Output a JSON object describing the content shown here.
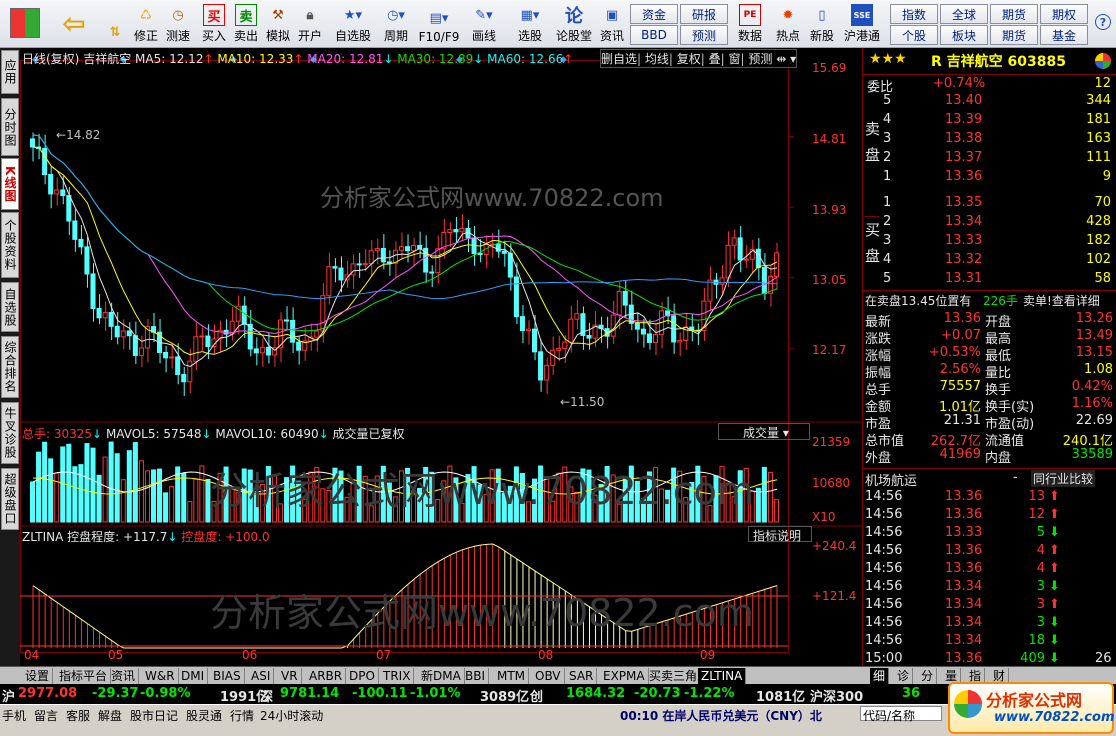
{
  "toolbar": {
    "buttons": [
      "修正",
      "测速",
      "买入",
      "卖出",
      "模拟",
      "开户",
      "自选股",
      "周期",
      "F10/F9",
      "画线",
      "选股",
      "论股堂",
      "资讯",
      "数据",
      "热点",
      "新股",
      "沪港通"
    ],
    "grid_top": [
      "资金",
      "研报"
    ],
    "grid_bottom": [
      "BBD",
      "预测"
    ],
    "right_top": [
      "指数",
      "全球",
      "期货",
      "期权"
    ],
    "right_bottom": [
      "个股",
      "板块",
      "期货",
      "基金"
    ]
  },
  "left_tabs": [
    "应用",
    "分时图",
    "K线图",
    "个股资料",
    "自选股",
    "综合排名",
    "牛叉诊股",
    "超级盘口"
  ],
  "chart": {
    "header": {
      "period": "日线(复权)",
      "name": "吉祥航空",
      "ma5": "MA5: 12.12",
      "ma10": "MA10: 12.33",
      "ma20": "MA20: 12.81",
      "ma30": "MA30: 12.89",
      "ma60": "MA60: 12.66"
    },
    "top_buttons": [
      "删自选",
      "均线",
      "复权",
      "叠",
      "窗",
      "预测"
    ],
    "price_ticks": [
      "15.69",
      "14.81",
      "13.93",
      "13.05",
      "12.17"
    ],
    "high_label": "14.82",
    "low_label": "11.50",
    "volume": {
      "label": "总手: 30325",
      "mavol5": "MAVOL5: 57548",
      "mavol10": "MAVOL10: 60490",
      "note": "成交量已复权",
      "dropdown": "成交量",
      "ticks": [
        "21359",
        "10680",
        "X10"
      ]
    },
    "indicator": {
      "name": "ZLTINA",
      "a": "控盘程度: +117.7",
      "b": "控盘度: +100.0",
      "btn": "指标说明",
      "ticks": [
        "+240.4",
        "+121.4"
      ]
    },
    "months": [
      "04",
      "05",
      "06",
      "07",
      "08",
      "09"
    ],
    "watermark": "分析家公式网www.70822.com"
  },
  "chart_data": {
    "type": "candlestick",
    "title": "吉祥航空 日线(复权)",
    "ylim": [
      11.3,
      15.69
    ],
    "ma": {
      "MA5": 12.12,
      "MA10": 12.33,
      "MA20": 12.81,
      "MA30": 12.89,
      "MA60": 12.66
    },
    "high": 14.82,
    "low": 11.5,
    "volume_ylim": [
      0,
      21359
    ],
    "indicator_ylim": [
      0,
      240.4
    ]
  },
  "quote": {
    "title": "R 吉祥航空 603885",
    "weibi_label": "委比",
    "weibi": "+0.74%",
    "weibi_v": "12",
    "sell": [
      {
        "n": "5",
        "p": "13.40",
        "v": "344"
      },
      {
        "n": "4",
        "p": "13.39",
        "v": "181"
      },
      {
        "n": "3",
        "p": "13.38",
        "v": "163"
      },
      {
        "n": "2",
        "p": "13.37",
        "v": "111"
      },
      {
        "n": "1",
        "p": "13.36",
        "v": "9"
      }
    ],
    "buy": [
      {
        "n": "1",
        "p": "13.35",
        "v": "70"
      },
      {
        "n": "2",
        "p": "13.34",
        "v": "428"
      },
      {
        "n": "3",
        "p": "13.33",
        "v": "182"
      },
      {
        "n": "4",
        "p": "13.32",
        "v": "102"
      },
      {
        "n": "5",
        "p": "13.31",
        "v": "58"
      }
    ],
    "sell_label": "卖盘",
    "buy_label": "买盘",
    "position": "在卖盘13.45位置有",
    "pos_vol": "226手",
    "detail": "卖单!查看详细",
    "stats": [
      [
        "最新",
        "13.36",
        "开盘",
        "13.26"
      ],
      [
        "涨跌",
        "+0.07",
        "最高",
        "13.49"
      ],
      [
        "涨幅",
        "+0.53%",
        "最低",
        "13.15"
      ],
      [
        "振幅",
        "2.56%",
        "量比",
        "1.08"
      ],
      [
        "总手",
        "75557",
        "换手",
        "0.42%"
      ],
      [
        "金额",
        "1.01亿",
        "换手(实)",
        "1.16%"
      ],
      [
        "市盈",
        "21.31",
        "市盈(动)",
        "22.69"
      ],
      [
        "总市值",
        "262.7亿",
        "流通值",
        "240.1亿"
      ],
      [
        "外盘",
        "41969",
        "内盘",
        "33589"
      ]
    ],
    "sector": "机场航运",
    "compare": "同行业比较",
    "ticks": [
      [
        "14:56",
        "13.36",
        "13"
      ],
      [
        "14:56",
        "13.36",
        "12"
      ],
      [
        "14:56",
        "13.33",
        "5"
      ],
      [
        "14:56",
        "13.36",
        "4"
      ],
      [
        "14:56",
        "13.36",
        "4"
      ],
      [
        "14:56",
        "13.34",
        "3"
      ],
      [
        "14:56",
        "13.34",
        "3"
      ],
      [
        "14:56",
        "13.34",
        "3"
      ],
      [
        "14:56",
        "13.34",
        "18"
      ],
      [
        "15:00",
        "13.36",
        "409"
      ]
    ],
    "last_extra": "26"
  },
  "bottom_tabs": [
    "设置",
    "指标平台",
    "资讯",
    "W&R",
    "DMI",
    "BIAS",
    "ASI",
    "VR",
    "ARBR",
    "DPO",
    "TRIX",
    "新DMA",
    "BBI",
    "MTM",
    "OBV",
    "SAR",
    "EXPMA",
    "买卖三角",
    "ZLTINA"
  ],
  "right_tabs": [
    "细",
    "诊",
    "分",
    "量",
    "指",
    "财"
  ],
  "ticker": {
    "sh": "沪",
    "sh_v": "2977.08",
    "sh_c": "-29.37",
    "sh_p": "-0.98%",
    "sh_a": "1991亿",
    "sz": "深",
    "sz_v": "9781.14",
    "sz_c": "-100.11",
    "sz_p": "-1.01%",
    "sz_a": "3089亿",
    "cy": "创",
    "cy_v": "1684.32",
    "cy_c": "-20.73",
    "cy_p": "-1.22%",
    "cy_a": "1081亿",
    "hs": "沪深300",
    "hs_v": "36"
  },
  "status": {
    "items": [
      "手机",
      "留言",
      "客服",
      "解盘",
      "股市日记",
      "股灵通",
      "行情",
      "24小时滚动"
    ],
    "news": "00:10 在岸人民币兑美元（CNY）北",
    "search": "代码/名称"
  },
  "logo": {
    "name": "分析家公式网",
    "url": "www.70822.com"
  }
}
